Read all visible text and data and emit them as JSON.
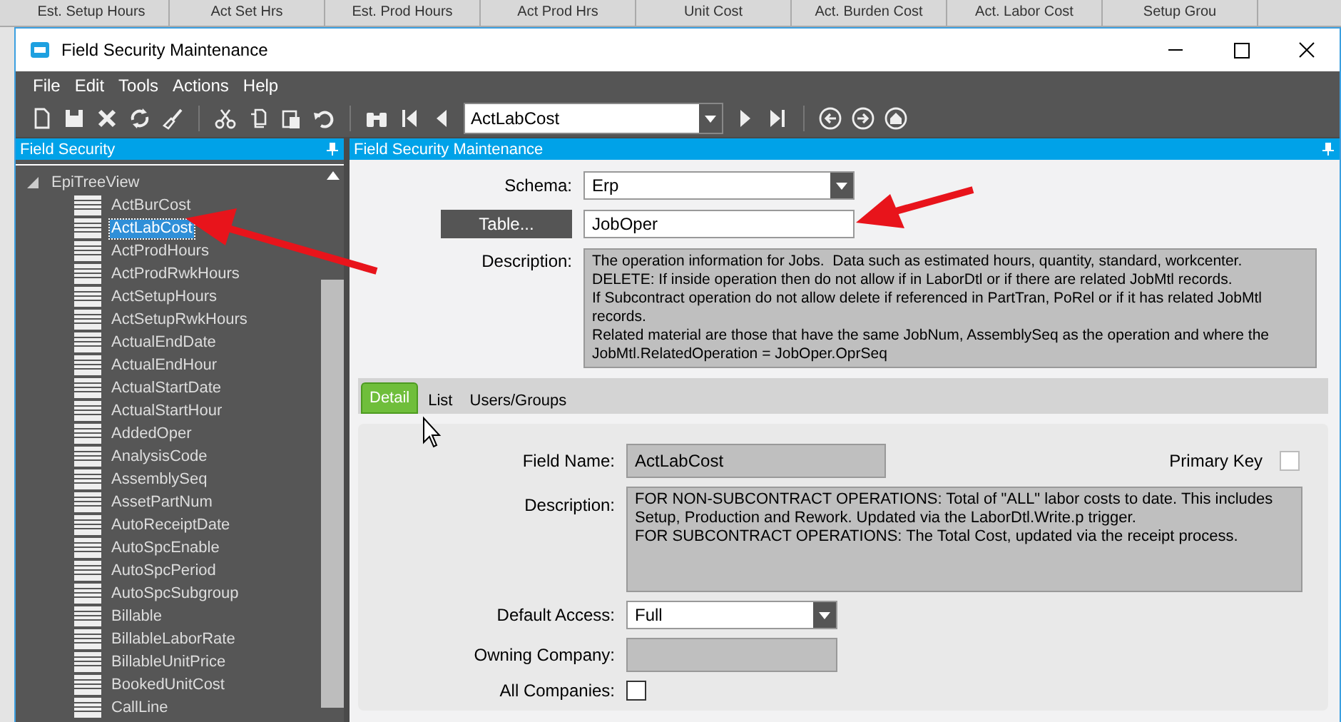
{
  "background_grid": {
    "columns": [
      "Est. Setup Hours",
      "Act Set Hrs",
      "Est. Prod Hours",
      "Act Prod Hrs",
      "Unit Cost",
      "Act. Burden Cost",
      "Act. Labor Cost",
      "Setup Grou"
    ]
  },
  "window": {
    "title": "Field Security Maintenance"
  },
  "menu": [
    "File",
    "Edit",
    "Tools",
    "Actions",
    "Help"
  ],
  "toolbar": {
    "record": "ActLabCost"
  },
  "left_panel": {
    "title": "Field Security",
    "tree": {
      "label": "EpiTreeView",
      "expanded": true,
      "children": [
        {
          "label": "ActBurCost",
          "selected": false
        },
        {
          "label": "ActLabCost",
          "selected": true
        },
        {
          "label": "ActProdHours",
          "selected": false
        },
        {
          "label": "ActProdRwkHours",
          "selected": false
        },
        {
          "label": "ActSetupHours",
          "selected": false
        },
        {
          "label": "ActSetupRwkHours",
          "selected": false
        },
        {
          "label": "ActualEndDate",
          "selected": false
        },
        {
          "label": "ActualEndHour",
          "selected": false
        },
        {
          "label": "ActualStartDate",
          "selected": false
        },
        {
          "label": "ActualStartHour",
          "selected": false
        },
        {
          "label": "AddedOper",
          "selected": false
        },
        {
          "label": "AnalysisCode",
          "selected": false
        },
        {
          "label": "AssemblySeq",
          "selected": false
        },
        {
          "label": "AssetPartNum",
          "selected": false
        },
        {
          "label": "AutoReceiptDate",
          "selected": false
        },
        {
          "label": "AutoSpcEnable",
          "selected": false
        },
        {
          "label": "AutoSpcPeriod",
          "selected": false
        },
        {
          "label": "AutoSpcSubgroup",
          "selected": false
        },
        {
          "label": "Billable",
          "selected": false
        },
        {
          "label": "BillableLaborRate",
          "selected": false
        },
        {
          "label": "BillableUnitPrice",
          "selected": false
        },
        {
          "label": "BookedUnitCost",
          "selected": false
        },
        {
          "label": "CallLine",
          "selected": false
        }
      ]
    }
  },
  "right_panel": {
    "title": "Field Security Maintenance",
    "schema": {
      "label": "Schema:",
      "value": "Erp"
    },
    "table": {
      "button": "Table...",
      "value": "JobOper"
    },
    "description": {
      "label": "Description:",
      "text": "The operation information for Jobs.  Data such as estimated hours, quantity, standard, workcenter.\nDELETE: If inside operation then do not allow if in LaborDtl or if there are related JobMtl records.\nIf Subcontract operation do not allow delete if referenced in PartTran, PoRel or if it has related JobMtl records.\nRelated material are those that have the same JobNum, AssemblySeq as the operation and where the JobMtl.RelatedOperation = JobOper.OprSeq"
    },
    "tabs": [
      {
        "label": "Detail",
        "selected": true
      },
      {
        "label": "List",
        "selected": false
      },
      {
        "label": "Users/Groups",
        "selected": false
      }
    ],
    "detail": {
      "field_name": {
        "label": "Field Name:",
        "value": "ActLabCost"
      },
      "primary_key": {
        "label": "Primary Key",
        "checked": false
      },
      "description": {
        "label": "Description:",
        "text": "FOR NON-SUBCONTRACT OPERATIONS: Total of \"ALL\" labor costs to date. This includes Setup, Production and Rework. Updated via the LaborDtl.Write.p trigger.\nFOR SUBCONTRACT OPERATIONS: The Total Cost, updated via the receipt process."
      },
      "default_access": {
        "label": "Default Access:",
        "value": "Full"
      },
      "owning_company": {
        "label": "Owning Company:"
      },
      "all_companies": {
        "label": "All Companies:",
        "checked": false
      }
    }
  }
}
